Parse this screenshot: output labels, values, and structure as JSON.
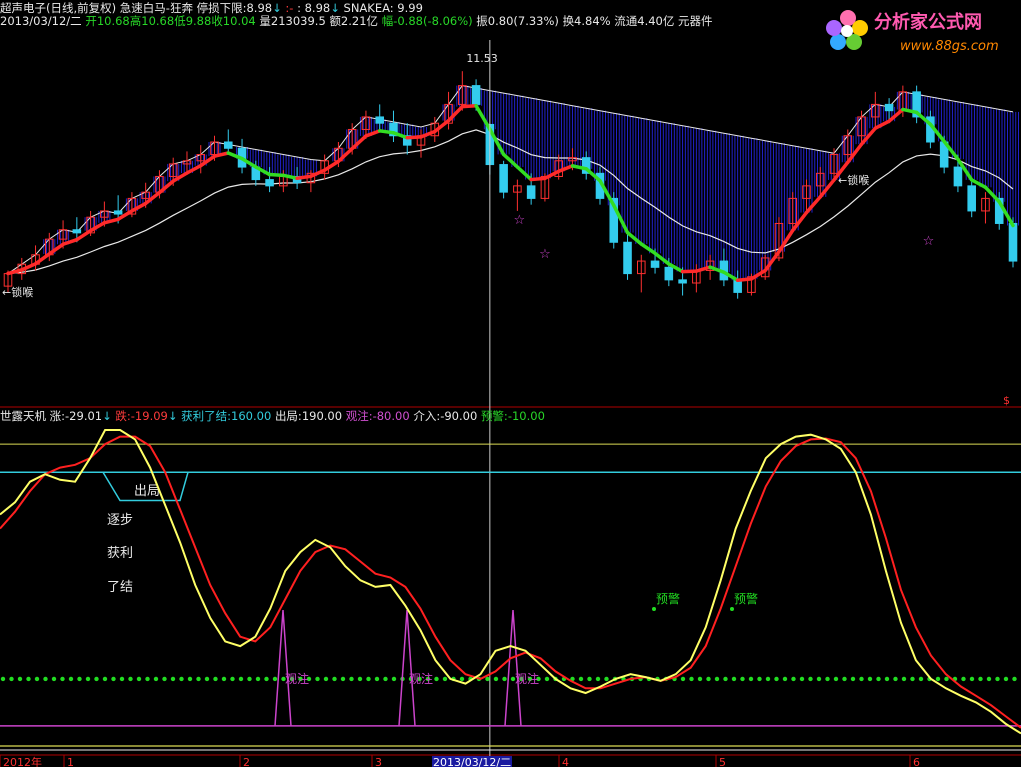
{
  "colors": {
    "background": "#000000",
    "grid": "#b00000",
    "candle_up": "#ff3030",
    "candle_down": "#33ccee",
    "line_red": "#ff2a2a",
    "line_green": "#33dd22",
    "line_white": "#e8e8e8",
    "cloud_blue": "#2222cc",
    "k_line": "#ffff66",
    "d_line": "#ff2020",
    "cyan_level": "#33ccdd",
    "green_dots": "#22dd22",
    "magenta": "#cc44cc"
  },
  "header": {
    "line1": {
      "name": "超声电子(日线,前复权)",
      "indicator": "急速白马-狂奔",
      "stop_label": "停损下限:",
      "stop_value": "8.98",
      "stop_arrow": "↓",
      "dash": ":",
      "dash2": "-",
      "value2": ": 8.98",
      "arrow2": "↓",
      "snake": "SNAKEA: 9.99"
    },
    "line2": {
      "date": "2013/03/12/二",
      "open": "开10.68",
      "high": "高10.68",
      "low": "低9.88",
      "close": "收10.04",
      "volume": "量213039.5",
      "amount": "额2.21亿",
      "change": "幅-0.88(-8.06%)",
      "amplitude": "振0.80(7.33%)",
      "turnover": "换4.84%",
      "float": "流通4.40亿",
      "sector": "元器件"
    }
  },
  "logo": {
    "text": "分析家公式网",
    "url": "www.88gs.com"
  },
  "main_chart": {
    "ylim": [
      7.4,
      11.9
    ],
    "peak_label": "11.53",
    "annotations": [
      "←锁喉",
      "←锁喉"
    ],
    "dollar": "$",
    "candles": [
      [
        8.1,
        8.35,
        8.0,
        8.3
      ],
      [
        8.3,
        8.55,
        8.2,
        8.45
      ],
      [
        8.45,
        8.75,
        8.35,
        8.6
      ],
      [
        8.6,
        8.95,
        8.5,
        8.85
      ],
      [
        8.85,
        9.15,
        8.7,
        9.0
      ],
      [
        9.0,
        9.2,
        8.8,
        8.95
      ],
      [
        8.95,
        9.3,
        8.9,
        9.2
      ],
      [
        9.2,
        9.45,
        9.05,
        9.3
      ],
      [
        9.3,
        9.55,
        9.1,
        9.25
      ],
      [
        9.25,
        9.6,
        9.2,
        9.5
      ],
      [
        9.5,
        9.75,
        9.35,
        9.6
      ],
      [
        9.6,
        9.95,
        9.5,
        9.85
      ],
      [
        9.85,
        10.15,
        9.7,
        10.05
      ],
      [
        10.05,
        10.25,
        9.9,
        10.1
      ],
      [
        10.1,
        10.35,
        9.9,
        10.2
      ],
      [
        10.2,
        10.5,
        10.1,
        10.4
      ],
      [
        10.4,
        10.6,
        10.2,
        10.3
      ],
      [
        10.3,
        10.45,
        9.9,
        10.0
      ],
      [
        10.0,
        10.1,
        9.7,
        9.8
      ],
      [
        9.8,
        10.0,
        9.6,
        9.7
      ],
      [
        9.7,
        9.95,
        9.6,
        9.85
      ],
      [
        9.85,
        10.0,
        9.65,
        9.75
      ],
      [
        9.75,
        9.95,
        9.6,
        9.9
      ],
      [
        9.9,
        10.2,
        9.8,
        10.1
      ],
      [
        10.1,
        10.4,
        10.0,
        10.3
      ],
      [
        10.3,
        10.7,
        10.2,
        10.6
      ],
      [
        10.6,
        10.9,
        10.45,
        10.8
      ],
      [
        10.8,
        11.0,
        10.6,
        10.7
      ],
      [
        10.7,
        10.9,
        10.4,
        10.5
      ],
      [
        10.5,
        10.7,
        10.2,
        10.35
      ],
      [
        10.35,
        10.6,
        10.15,
        10.5
      ],
      [
        10.5,
        10.8,
        10.4,
        10.7
      ],
      [
        10.7,
        11.2,
        10.6,
        11.0
      ],
      [
        11.0,
        11.53,
        10.9,
        11.3
      ],
      [
        11.3,
        11.4,
        10.9,
        11.0
      ],
      [
        10.68,
        10.68,
        9.88,
        10.04
      ],
      [
        10.04,
        10.1,
        9.5,
        9.6
      ],
      [
        9.6,
        9.8,
        9.3,
        9.7
      ],
      [
        9.7,
        9.9,
        9.4,
        9.5
      ],
      [
        9.5,
        9.9,
        9.45,
        9.85
      ],
      [
        9.85,
        10.2,
        9.8,
        10.1
      ],
      [
        10.1,
        10.3,
        9.95,
        10.15
      ],
      [
        10.15,
        10.25,
        9.8,
        9.9
      ],
      [
        9.9,
        10.0,
        9.4,
        9.5
      ],
      [
        9.5,
        9.6,
        8.7,
        8.8
      ],
      [
        8.8,
        8.95,
        8.2,
        8.3
      ],
      [
        8.3,
        8.6,
        8.0,
        8.5
      ],
      [
        8.5,
        8.7,
        8.3,
        8.4
      ],
      [
        8.4,
        8.55,
        8.1,
        8.2
      ],
      [
        8.2,
        8.4,
        7.95,
        8.15
      ],
      [
        8.15,
        8.45,
        8.0,
        8.35
      ],
      [
        8.35,
        8.6,
        8.2,
        8.5
      ],
      [
        8.5,
        8.7,
        8.1,
        8.2
      ],
      [
        8.2,
        8.35,
        7.9,
        8.0
      ],
      [
        8.0,
        8.3,
        7.95,
        8.25
      ],
      [
        8.25,
        8.6,
        8.2,
        8.55
      ],
      [
        8.55,
        9.2,
        8.5,
        9.1
      ],
      [
        9.1,
        9.6,
        9.0,
        9.5
      ],
      [
        9.5,
        9.8,
        9.3,
        9.7
      ],
      [
        9.7,
        10.0,
        9.55,
        9.9
      ],
      [
        9.9,
        10.3,
        9.8,
        10.2
      ],
      [
        10.2,
        10.6,
        10.1,
        10.5
      ],
      [
        10.5,
        10.9,
        10.4,
        10.8
      ],
      [
        10.8,
        11.2,
        10.6,
        11.0
      ],
      [
        11.0,
        11.1,
        10.7,
        10.9
      ],
      [
        10.9,
        11.3,
        10.8,
        11.2
      ],
      [
        11.2,
        11.3,
        10.7,
        10.8
      ],
      [
        10.8,
        10.9,
        10.3,
        10.4
      ],
      [
        10.4,
        10.5,
        9.9,
        10.0
      ],
      [
        10.0,
        10.2,
        9.6,
        9.7
      ],
      [
        9.7,
        9.8,
        9.2,
        9.3
      ],
      [
        9.3,
        9.6,
        9.1,
        9.5
      ],
      [
        9.5,
        9.6,
        9.0,
        9.1
      ],
      [
        9.1,
        9.2,
        8.4,
        8.5
      ]
    ]
  },
  "sub_chart": {
    "title": "世露天机",
    "zhang_label": "涨:",
    "zhang_value": "-29.01",
    "die_label": "跌:",
    "die_value": "-19.09",
    "profit_label": "获利了结:",
    "profit_value": "160.00",
    "exit_label": "出局:",
    "exit_value": "190.00",
    "watch_label": "观注:",
    "watch_value": "-80.00",
    "enter_label": "介入:",
    "enter_value": "-90.00",
    "warn_label": "预警:",
    "warn_value": "-10.00",
    "ylim": [
      -125,
      205
    ],
    "exit_box": "出局",
    "gradual": "逐步",
    "profit": "获利",
    "close": "了结",
    "watch_marks": [
      "观注",
      "观注",
      "观注"
    ],
    "warn_marks": [
      "预警",
      "预警"
    ],
    "k": [
      115,
      128,
      150,
      158,
      152,
      150,
      175,
      205,
      205,
      195,
      165,
      125,
      85,
      40,
      5,
      -20,
      -25,
      -15,
      15,
      55,
      75,
      88,
      80,
      60,
      45,
      38,
      40,
      18,
      -8,
      -40,
      -60,
      -65,
      -55,
      -30,
      -25,
      -30,
      -45,
      -60,
      -70,
      -75,
      -68,
      -60,
      -55,
      -58,
      -62,
      -55,
      -40,
      -5,
      45,
      100,
      140,
      175,
      190,
      198,
      200,
      195,
      185,
      160,
      115,
      55,
      0,
      -40,
      -60,
      -70,
      -78,
      -85,
      -95,
      -108,
      -118
    ],
    "d": [
      100,
      118,
      140,
      158,
      165,
      168,
      175,
      190,
      198,
      198,
      188,
      160,
      120,
      80,
      40,
      10,
      -15,
      -20,
      -5,
      25,
      55,
      75,
      82,
      78,
      65,
      52,
      48,
      38,
      15,
      -15,
      -40,
      -55,
      -60,
      -52,
      -38,
      -32,
      -38,
      -52,
      -62,
      -70,
      -70,
      -65,
      -60,
      -58,
      -62,
      -58,
      -48,
      -25,
      15,
      60,
      105,
      145,
      172,
      188,
      195,
      196,
      192,
      175,
      140,
      90,
      35,
      -5,
      -35,
      -55,
      -68,
      -78,
      -88,
      -100,
      -112
    ]
  },
  "x_axis": {
    "labels": [
      "2012年",
      "1",
      "2",
      "3",
      "2013/03/12/二",
      "4",
      "5",
      "6"
    ]
  }
}
